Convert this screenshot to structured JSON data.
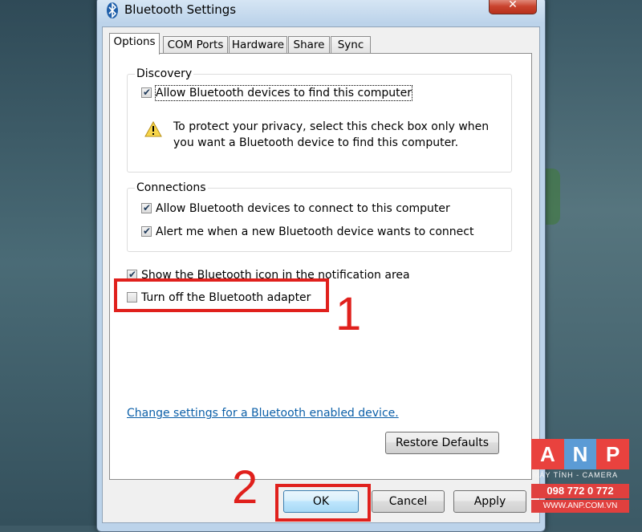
{
  "window": {
    "title": "Bluetooth Settings",
    "close_glyph": "✕"
  },
  "tabs": [
    {
      "label": "Options",
      "active": true
    },
    {
      "label": "COM Ports"
    },
    {
      "label": "Hardware"
    },
    {
      "label": "Share"
    },
    {
      "label": "Sync"
    }
  ],
  "discovery": {
    "title": "Discovery",
    "allow_find": {
      "label": "Allow Bluetooth devices to find this computer",
      "checked": true
    },
    "warning_line1": "To protect your privacy, select this check box only when",
    "warning_line2": "you want a Bluetooth device to find this computer."
  },
  "connections": {
    "title": "Connections",
    "allow_connect": {
      "label": "Allow Bluetooth devices to connect to this computer",
      "checked": true
    },
    "alert_me": {
      "label": "Alert me when a new Bluetooth device wants to connect",
      "checked": true
    }
  },
  "show_icon": {
    "label": "Show the Bluetooth icon in the notification area",
    "checked": true
  },
  "turn_off": {
    "label": "Turn off the Bluetooth adapter",
    "checked": false
  },
  "link": "Change settings for a Bluetooth enabled device.",
  "buttons": {
    "restore": "Restore Defaults",
    "ok": "OK",
    "cancel": "Cancel",
    "apply": "Apply"
  },
  "annotations": {
    "step1": "1",
    "step2": "2"
  },
  "watermark": {
    "letters": [
      "A",
      "N",
      "P"
    ],
    "letter_colors": [
      "#e9423e",
      "#5b9bd5",
      "#e9423e"
    ],
    "subtitle": "MÁY TÍNH - CAMERA",
    "phone": "098 772 0 772",
    "url": "WWW.ANP.COM.VN"
  },
  "colors": {
    "accent_red": "#e0201c",
    "link_blue": "#0b5fa8"
  },
  "icons": {
    "title": "bluetooth-icon",
    "warning": "warning-icon"
  }
}
